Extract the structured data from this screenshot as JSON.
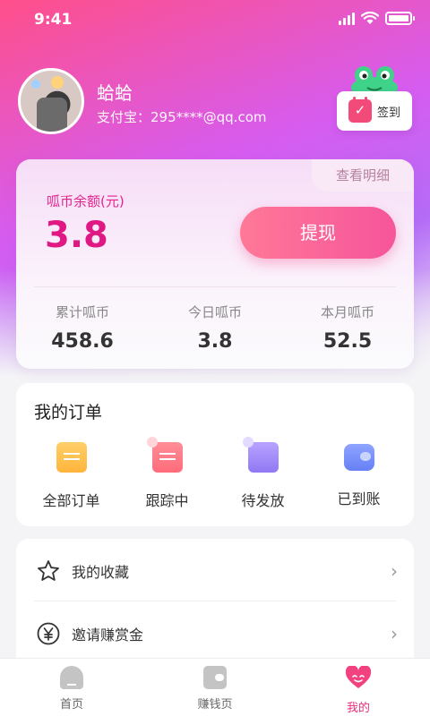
{
  "status_bar": {
    "time": "9:41"
  },
  "profile": {
    "name": "蛤蛤",
    "account": "支付宝：295****@qq.com"
  },
  "checkin": {
    "label": "签到"
  },
  "wallet": {
    "detail_link": "查看明细",
    "balance_label": "呱币余额(元)",
    "balance_value": "3.8",
    "withdraw_label": "提现",
    "stats": [
      {
        "label": "累计呱币",
        "value": "458.6"
      },
      {
        "label": "今日呱币",
        "value": "3.8"
      },
      {
        "label": "本月呱币",
        "value": "52.5"
      }
    ]
  },
  "orders": {
    "title": "我的订单",
    "items": [
      {
        "label": "全部订单",
        "icon": "all-orders-icon"
      },
      {
        "label": "跟踪中",
        "icon": "tracking-icon"
      },
      {
        "label": "待发放",
        "icon": "pending-icon"
      },
      {
        "label": "已到账",
        "icon": "wallet-received-icon"
      }
    ]
  },
  "menu": {
    "items": [
      {
        "label": "我的收藏",
        "icon": "star-icon"
      },
      {
        "label": "邀请赚赏金",
        "icon": "yen-icon"
      }
    ]
  },
  "tabbar": {
    "items": [
      {
        "label": "首页",
        "icon": "home-icon",
        "active": false
      },
      {
        "label": "赚钱页",
        "icon": "wallet-icon",
        "active": false
      },
      {
        "label": "我的",
        "icon": "heart-face-icon",
        "active": true
      }
    ]
  },
  "colors": {
    "accent": "#e01883",
    "gradient_start": "#ff4f8a",
    "gradient_end": "#b46cf7",
    "active_tab": "#e8307c"
  }
}
